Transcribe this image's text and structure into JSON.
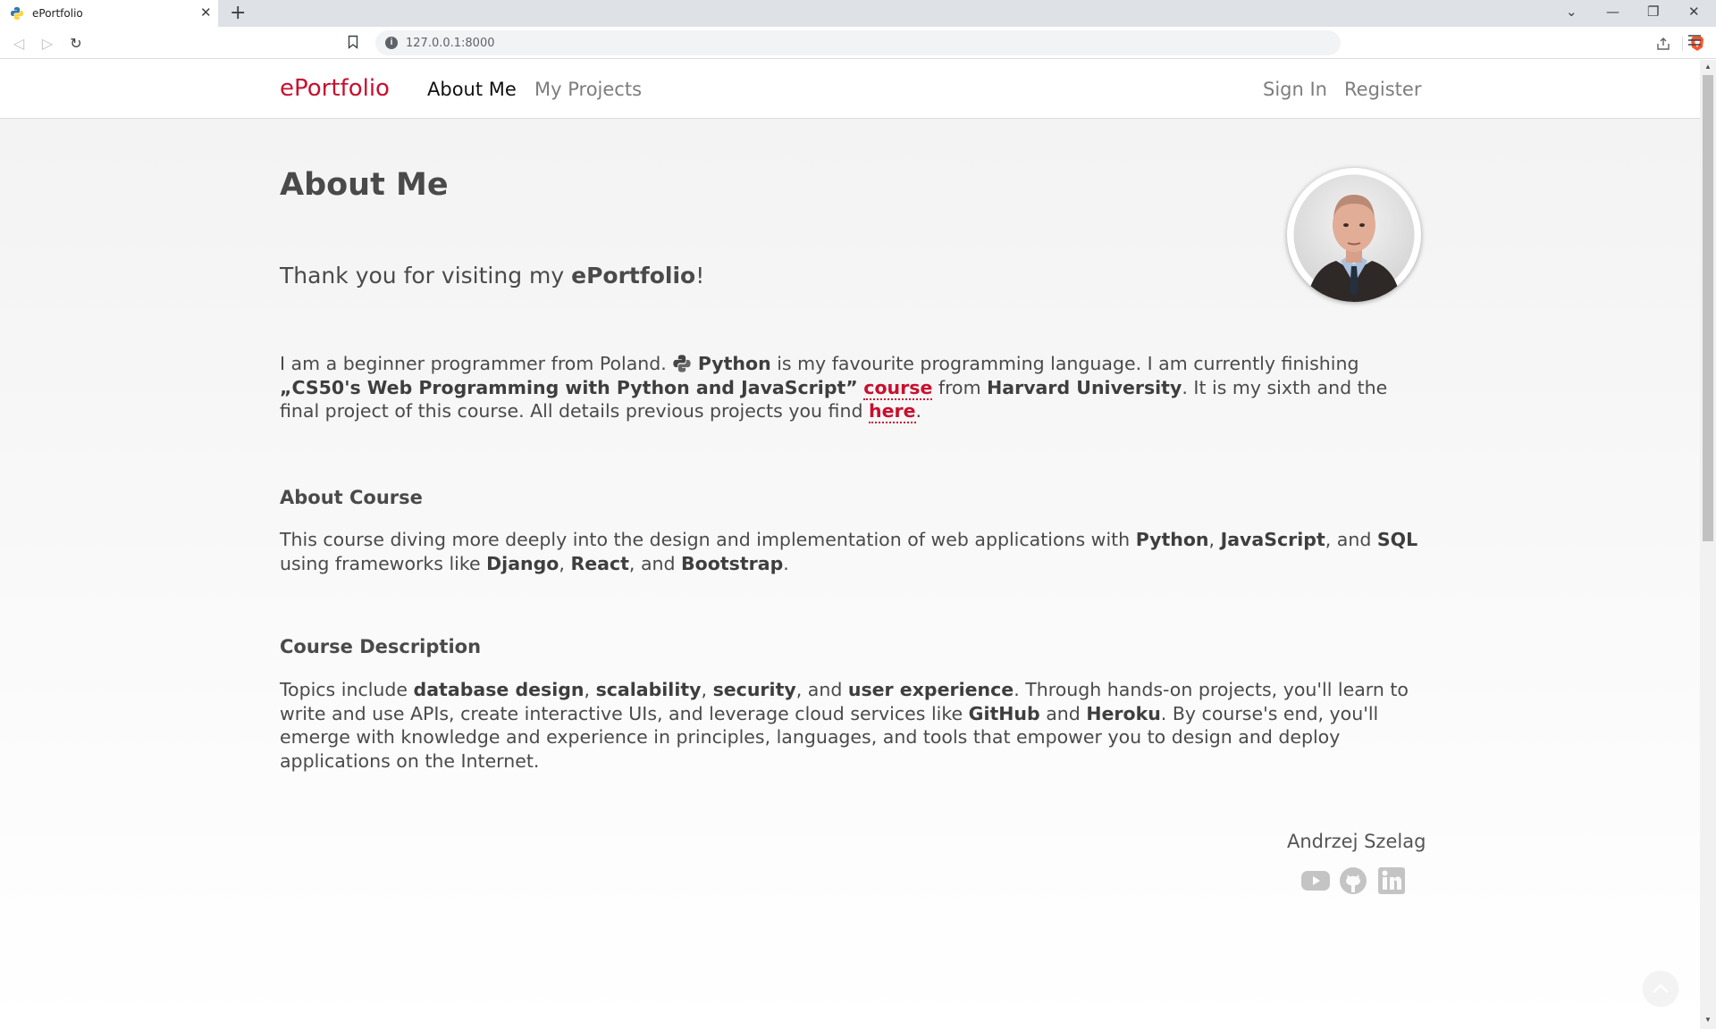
{
  "browser": {
    "tab_title": "ePortfolio",
    "tab_close": "✕",
    "new_tab": "+",
    "url": "127.0.0.1:8000",
    "window_controls": [
      "⌄",
      "—",
      "❐",
      "✕"
    ]
  },
  "navbar": {
    "brand": "ePortfolio",
    "links": [
      "About Me",
      "My Projects"
    ],
    "auth": [
      "Sign In",
      "Register"
    ]
  },
  "main": {
    "title": "About Me",
    "lead_prefix": "Thank you for visiting my ",
    "lead_bold": "ePortfolio",
    "lead_suffix": "!",
    "intro": {
      "t1": "I am a beginner programmer from Poland. ",
      "python": "Python",
      "t2": " is my favourite programming language. I am currently finishing ",
      "course_name": "„CS50's Web Programming with Python and JavaScript”",
      "course_link": "course",
      "t3": " from ",
      "university": "Harvard University",
      "t4": ". It is my sixth and the final project of this course. All details previous projects you find ",
      "here_link": "here",
      "t5": "."
    },
    "about_course": {
      "heading": "About Course",
      "t1": "This course diving more deeply into the design and implementation of web applications with ",
      "python": "Python",
      "c1": ", ",
      "javascript": "JavaScript",
      "c2": ", and ",
      "sql": "SQL",
      "t2": " using frameworks like ",
      "django": "Django",
      "c3": ", ",
      "react": "React",
      "c4": ", and ",
      "bootstrap": "Bootstrap",
      "t3": "."
    },
    "course_description": {
      "heading": "Course Description",
      "t1": "Topics include ",
      "db": "database design",
      "c1": ", ",
      "scal": "scalability",
      "c2": ", ",
      "sec": "security",
      "c3": ", and ",
      "ux": "user experience",
      "t2": ". Through hands-on projects, you'll learn to write and use APIs, create interactive UIs, and leverage cloud services like ",
      "github": "GitHub",
      "c4": " and ",
      "heroku": "Heroku",
      "t3": ". By course's end, you'll emerge with knowledge and experience in principles, languages, and tools that empower you to design and deploy applications on the Internet."
    }
  },
  "footer": {
    "name": "Andrzej Szelag",
    "social_icons": [
      "youtube-icon",
      "github-icon",
      "linkedin-icon"
    ]
  },
  "colors": {
    "accent": "#c8102e",
    "text": "#4a4a4a",
    "nav_inactive": "#7d7d7d",
    "icon_gray": "#c4c4c4"
  }
}
